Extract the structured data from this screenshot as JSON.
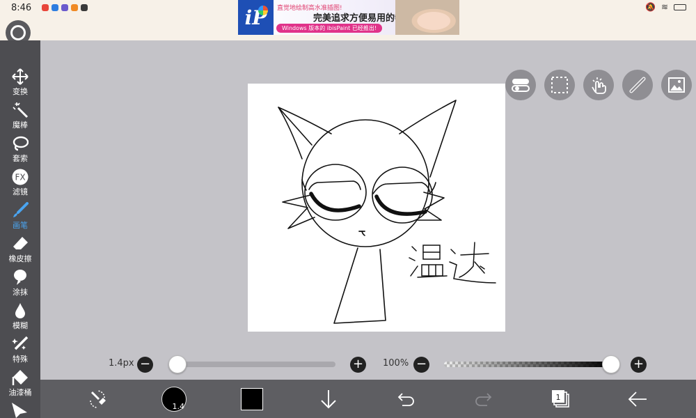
{
  "status_bar": {
    "time": "8:46"
  },
  "ad": {
    "logo": "iP",
    "line1": "直觉地绘制高水准插图!",
    "line2": "完美追求方便易用的特点!",
    "line3": "Windows 版本的 ibisPaint 已经推出!"
  },
  "tools": [
    {
      "label": "变换",
      "icon": "move-arrows-icon"
    },
    {
      "label": "魔棒",
      "icon": "magic-wand-icon"
    },
    {
      "label": "套索",
      "icon": "lasso-icon"
    },
    {
      "label": "滤镜",
      "icon": "fx-icon",
      "icon_text": "FX"
    },
    {
      "label": "画笔",
      "icon": "brush-icon",
      "active": true
    },
    {
      "label": "橡皮擦",
      "icon": "eraser-icon"
    },
    {
      "label": "涂抹",
      "icon": "smudge-icon"
    },
    {
      "label": "模糊",
      "icon": "blur-drop-icon"
    },
    {
      "label": "特殊",
      "icon": "sparkle-pen-icon"
    },
    {
      "label": "油漆桶",
      "icon": "paint-bucket-icon"
    }
  ],
  "canvas": {
    "signature_text": "温达"
  },
  "brush": {
    "size_label": "1.4px",
    "size_fraction": 0.02
  },
  "opacity": {
    "label": "100%",
    "fraction": 1.0
  },
  "bottom_bar": {
    "brush_preview_text": "1.4",
    "color": "#000000",
    "layer_count": "1"
  },
  "colors": {
    "accent": "#4aa4f0",
    "toolbar": "#4d4d51",
    "bottom_bar": "#5e5e62"
  }
}
